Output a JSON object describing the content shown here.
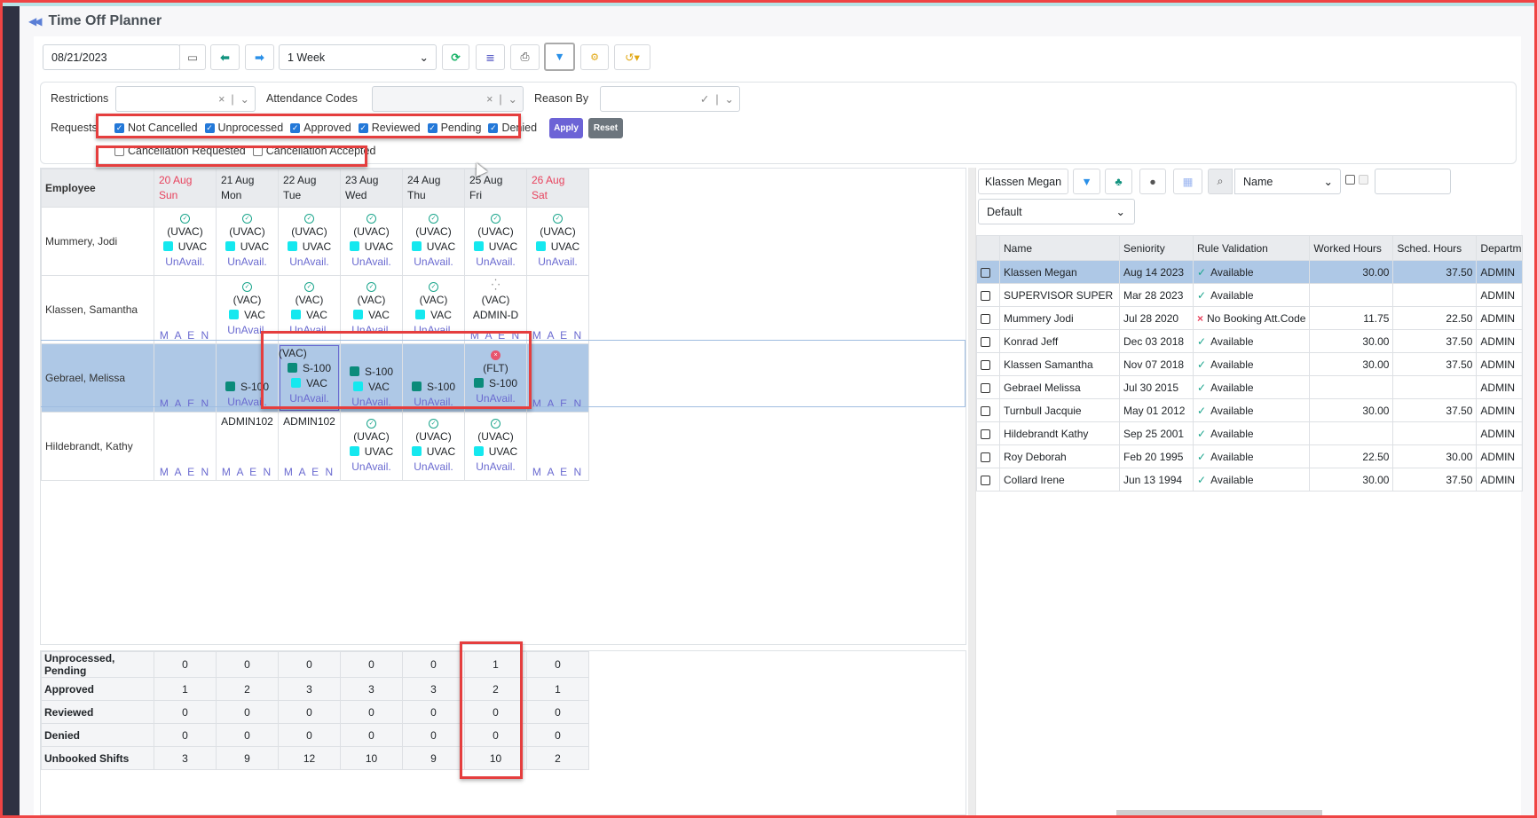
{
  "app": {
    "title": "Time Off Planner"
  },
  "toolbar": {
    "date_value": "08/21/2023",
    "range_value": "1 Week",
    "icons": [
      "calendar-icon",
      "arrow-left-icon",
      "arrow-right-icon",
      "refresh-icon",
      "database-icon",
      "print-icon",
      "filter-icon",
      "gears-icon",
      "history-icon"
    ]
  },
  "filters": {
    "restrictions_label": "Restrictions",
    "attendance_label": "Attendance Codes",
    "reason_label": "Reason By",
    "requests_label": "Requests",
    "request_options": [
      {
        "label": "Not Cancelled",
        "checked": true
      },
      {
        "label": "Unprocessed",
        "checked": true
      },
      {
        "label": "Approved",
        "checked": true
      },
      {
        "label": "Reviewed",
        "checked": true
      },
      {
        "label": "Pending",
        "checked": true
      },
      {
        "label": "Denied",
        "checked": true
      }
    ],
    "cancel_options": [
      {
        "label": "Cancellation Requested",
        "checked": false
      },
      {
        "label": "Cancellation Accepted",
        "checked": false
      }
    ],
    "apply_label": "Apply",
    "reset_label": "Reset"
  },
  "schedule": {
    "employee_header": "Employee",
    "days": [
      {
        "date": "20 Aug",
        "dow": "Sun",
        "weekend": true
      },
      {
        "date": "21 Aug",
        "dow": "Mon",
        "weekend": false
      },
      {
        "date": "22 Aug",
        "dow": "Tue",
        "weekend": false
      },
      {
        "date": "23 Aug",
        "dow": "Wed",
        "weekend": false
      },
      {
        "date": "24 Aug",
        "dow": "Thu",
        "weekend": false
      },
      {
        "date": "25 Aug",
        "dow": "Fri",
        "weekend": false
      },
      {
        "date": "26 Aug",
        "dow": "Sat",
        "weekend": true
      }
    ],
    "rows": [
      {
        "name": "Mummery, Jodi",
        "selected": false,
        "cells": [
          {
            "status": "approved",
            "lines": [
              "(UVAC)"
            ],
            "code": {
              "color": "cyan",
              "text": "UVAC"
            },
            "footer": "UnAvail."
          },
          {
            "status": "approved",
            "lines": [
              "(UVAC)"
            ],
            "code": {
              "color": "cyan",
              "text": "UVAC"
            },
            "footer": "UnAvail."
          },
          {
            "status": "approved",
            "lines": [
              "(UVAC)"
            ],
            "code": {
              "color": "cyan",
              "text": "UVAC"
            },
            "footer": "UnAvail."
          },
          {
            "status": "approved",
            "lines": [
              "(UVAC)"
            ],
            "code": {
              "color": "cyan",
              "text": "UVAC"
            },
            "footer": "UnAvail."
          },
          {
            "status": "approved",
            "lines": [
              "(UVAC)"
            ],
            "code": {
              "color": "cyan",
              "text": "UVAC"
            },
            "footer": "UnAvail."
          },
          {
            "status": "approved",
            "lines": [
              "(UVAC)"
            ],
            "code": {
              "color": "cyan",
              "text": "UVAC"
            },
            "footer": "UnAvail."
          },
          {
            "status": "approved",
            "lines": [
              "(UVAC)"
            ],
            "code": {
              "color": "cyan",
              "text": "UVAC"
            },
            "footer": "UnAvail."
          }
        ]
      },
      {
        "name": "Klassen, Samantha",
        "selected": false,
        "cells": [
          {
            "maen": "M A E N"
          },
          {
            "status": "approved",
            "lines": [
              "(VAC)"
            ],
            "code": {
              "color": "cyan",
              "text": "VAC"
            },
            "footer": "UnAvail."
          },
          {
            "status": "approved",
            "lines": [
              "(VAC)"
            ],
            "code": {
              "color": "cyan",
              "text": "VAC"
            },
            "footer": "UnAvail."
          },
          {
            "status": "approved",
            "lines": [
              "(VAC)"
            ],
            "code": {
              "color": "cyan",
              "text": "VAC"
            },
            "footer": "UnAvail."
          },
          {
            "status": "approved",
            "lines": [
              "(VAC)"
            ],
            "code": {
              "color": "cyan",
              "text": "VAC"
            },
            "footer": "UnAvail."
          },
          {
            "status": "pending",
            "lines": [
              "(VAC)",
              "ADMIN-D"
            ],
            "maen": "M A E N"
          },
          {
            "maen": "M A E N"
          }
        ]
      },
      {
        "name": "Gebrael, Melissa",
        "selected": true,
        "cells": [
          {
            "maen": "M A E N"
          },
          {
            "codes": [
              {
                "color": "teal",
                "text": "S-100"
              }
            ],
            "footer": "UnAvail."
          },
          {
            "lines": [
              "(VAC)"
            ],
            "codes": [
              {
                "color": "teal",
                "text": "S-100"
              },
              {
                "color": "cyan",
                "text": "VAC"
              }
            ],
            "footer": "UnAvail.",
            "focused": true
          },
          {
            "codes": [
              {
                "color": "teal",
                "text": "S-100"
              },
              {
                "color": "cyan",
                "text": "VAC"
              }
            ],
            "footer": "UnAvail."
          },
          {
            "codes": [
              {
                "color": "teal",
                "text": "S-100"
              }
            ],
            "footer": "UnAvail."
          },
          {
            "status": "denied",
            "lines": [
              "(FLT)"
            ],
            "codes": [
              {
                "color": "teal",
                "text": "S-100"
              }
            ],
            "footer": "UnAvail."
          },
          {
            "maen": "M A E N"
          }
        ]
      },
      {
        "name": "Hildebrandt, Kathy",
        "selected": false,
        "cells": [
          {
            "maen": "M A E N"
          },
          {
            "lines": [
              "ADMIN102"
            ],
            "maen": "M A E N"
          },
          {
            "lines": [
              "ADMIN102"
            ],
            "maen": "M A E N"
          },
          {
            "status": "approved",
            "lines": [
              "(UVAC)"
            ],
            "code": {
              "color": "cyan",
              "text": "UVAC"
            },
            "footer": "UnAvail."
          },
          {
            "status": "approved",
            "lines": [
              "(UVAC)"
            ],
            "code": {
              "color": "cyan",
              "text": "UVAC"
            },
            "footer": "UnAvail."
          },
          {
            "status": "approved",
            "lines": [
              "(UVAC)"
            ],
            "code": {
              "color": "cyan",
              "text": "UVAC"
            },
            "footer": "UnAvail."
          },
          {
            "maen": "M A E N"
          }
        ]
      }
    ]
  },
  "summary": {
    "rows": [
      {
        "label": "Unprocessed, Pending",
        "values": [
          0,
          0,
          0,
          0,
          0,
          1,
          0
        ]
      },
      {
        "label": "Approved",
        "values": [
          1,
          2,
          3,
          3,
          3,
          2,
          1
        ]
      },
      {
        "label": "Reviewed",
        "values": [
          0,
          0,
          0,
          0,
          0,
          0,
          0
        ]
      },
      {
        "label": "Denied",
        "values": [
          0,
          0,
          0,
          0,
          0,
          0,
          0
        ]
      },
      {
        "label": "Unbooked Shifts",
        "values": [
          3,
          9,
          12,
          10,
          9,
          10,
          2
        ]
      }
    ]
  },
  "right_panel": {
    "selected_employee": "Klassen Megan",
    "search_field": "Name",
    "search_value": "",
    "view": "Default",
    "columns": [
      "Name",
      "Seniority",
      "Rule Validation",
      "Worked Hours",
      "Sched. Hours",
      "Departm"
    ],
    "rows": [
      {
        "name": "Klassen Megan",
        "seniority": "Aug 14 2023",
        "rule": "Available",
        "rule_ok": true,
        "worked": "30.00",
        "sched": "37.50",
        "dept": "ADMIN",
        "highlight": true
      },
      {
        "name": "SUPERVISOR SUPER",
        "seniority": "Mar 28 2023",
        "rule": "Available",
        "rule_ok": true,
        "worked": "",
        "sched": "",
        "dept": "ADMIN"
      },
      {
        "name": "Mummery Jodi",
        "seniority": "Jul 28 2020",
        "rule": "No Booking Att.Code",
        "rule_ok": false,
        "worked": "11.75",
        "sched": "22.50",
        "dept": "ADMIN"
      },
      {
        "name": "Konrad Jeff",
        "seniority": "Dec 03 2018",
        "rule": "Available",
        "rule_ok": true,
        "worked": "30.00",
        "sched": "37.50",
        "dept": "ADMIN"
      },
      {
        "name": "Klassen Samantha",
        "seniority": "Nov 07 2018",
        "rule": "Available",
        "rule_ok": true,
        "worked": "30.00",
        "sched": "37.50",
        "dept": "ADMIN"
      },
      {
        "name": "Gebrael Melissa",
        "seniority": "Jul 30 2015",
        "rule": "Available",
        "rule_ok": true,
        "worked": "",
        "sched": "",
        "dept": "ADMIN"
      },
      {
        "name": "Turnbull Jacquie",
        "seniority": "May 01 2012",
        "rule": "Available",
        "rule_ok": true,
        "worked": "30.00",
        "sched": "37.50",
        "dept": "ADMIN"
      },
      {
        "name": "Hildebrandt Kathy",
        "seniority": "Sep 25 2001",
        "rule": "Available",
        "rule_ok": true,
        "worked": "",
        "sched": "",
        "dept": "ADMIN"
      },
      {
        "name": "Roy Deborah",
        "seniority": "Feb 20 1995",
        "rule": "Available",
        "rule_ok": true,
        "worked": "22.50",
        "sched": "30.00",
        "dept": "ADMIN"
      },
      {
        "name": "Collard Irene",
        "seniority": "Jun 13 1994",
        "rule": "Available",
        "rule_ok": true,
        "worked": "30.00",
        "sched": "37.50",
        "dept": "ADMIN"
      }
    ]
  },
  "colors": {
    "accent": "#2378d8",
    "weekend": "#e8425d",
    "selected_row": "#aec8e6",
    "highlight_box": "#e53e3e",
    "apply": "#6c63d6",
    "reset": "#6c757d"
  }
}
